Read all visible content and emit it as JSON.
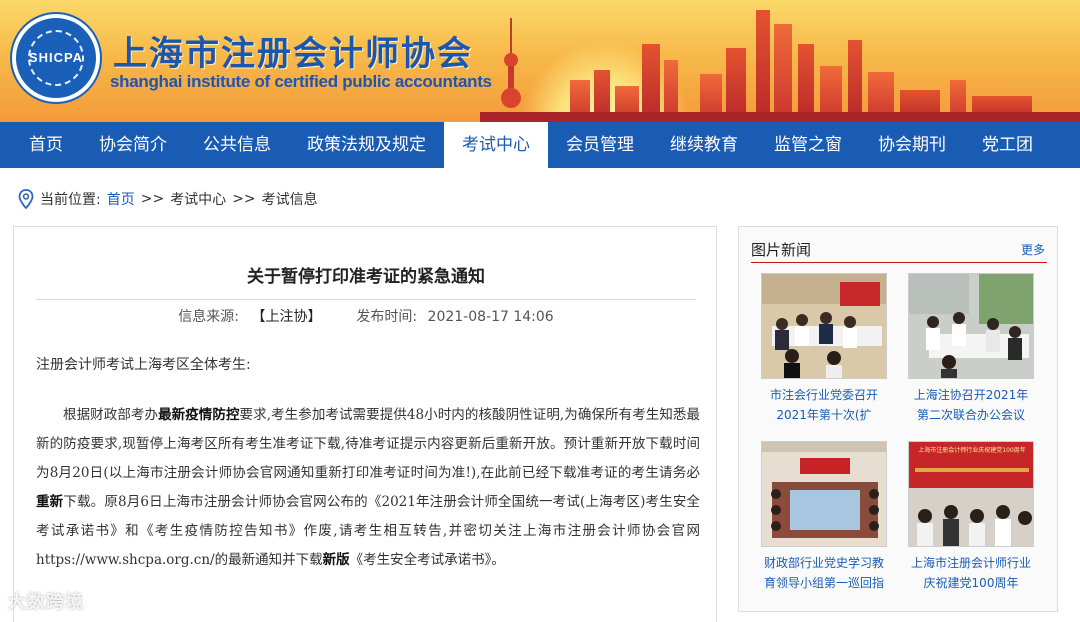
{
  "header": {
    "logo_text": "SHICPA",
    "title_cn": "上海市注册会计师协会",
    "title_en": "shanghai institute of certified public accountants",
    "colors": {
      "banner_top": "#fbd96a",
      "banner_bottom": "#f39a3a",
      "brand_blue": "#1a5bb4"
    }
  },
  "nav": {
    "items": [
      "首页",
      "协会简介",
      "公共信息",
      "政策法规及规定",
      "考试中心",
      "会员管理",
      "继续教育",
      "监管之窗",
      "协会期刊",
      "党工团"
    ],
    "active": "考试中心"
  },
  "breadcrumb": {
    "prefix": "当前位置:",
    "home": "首页",
    "sep1": ">>",
    "level1": "考试中心",
    "sep2": ">>",
    "level2": "考试信息"
  },
  "article": {
    "title": "关于暂停打印准考证的紧急通知",
    "source_label": "信息来源:",
    "source_value": "【上注协】",
    "date_label": "发布时间:",
    "date_value": "2021-08-17 14:06",
    "salutation": "注册会计师考试上海考区全体考生:",
    "p1": "根据财政部考办",
    "p1_bold": "最新疫情防控",
    "p2": "要求,考生参加考试需要提供48小时内的核酸阴性证明,为确保所有考生知悉最新的防疫要求,现暂停上海考区所有考生准考证下载,待准考证提示内容更新后重新开放。预计重新开放下载时间为8月20日(以上海市注册会计师协会官网通知重新打印准考证时间为准!),在此前已经下载准考证的考生请务必",
    "p2_bold": "重新",
    "p3": "下载。原8月6日上海市注册会计师协会官网公布的《2021年注册会计师全国统一考试(上海考区)考生安全考试承诺书》和《考生疫情防控告知书》作废,请考生相互转告,并密切关注上海市注册会计师协会官网https://www.shcpa.org.cn/的最新通知并下载",
    "p3_bold": "新版",
    "p4": "《考生安全考试承诺书》。"
  },
  "pic_news": {
    "title": "图片新闻",
    "more": "更多",
    "items": [
      {
        "caption": "市注会行业党委召开2021年第十次(扩"
      },
      {
        "caption": "上海注协召开2021年第二次联合办公会议"
      },
      {
        "caption": "财政部行业党史学习教育领导小组第一巡回指"
      },
      {
        "caption": "上海市注册会计师行业庆祝建党100周年"
      }
    ],
    "banner_text_4": "上海市注册会计师行业庆祝建党100周年"
  },
  "watermark": "大数跨境"
}
